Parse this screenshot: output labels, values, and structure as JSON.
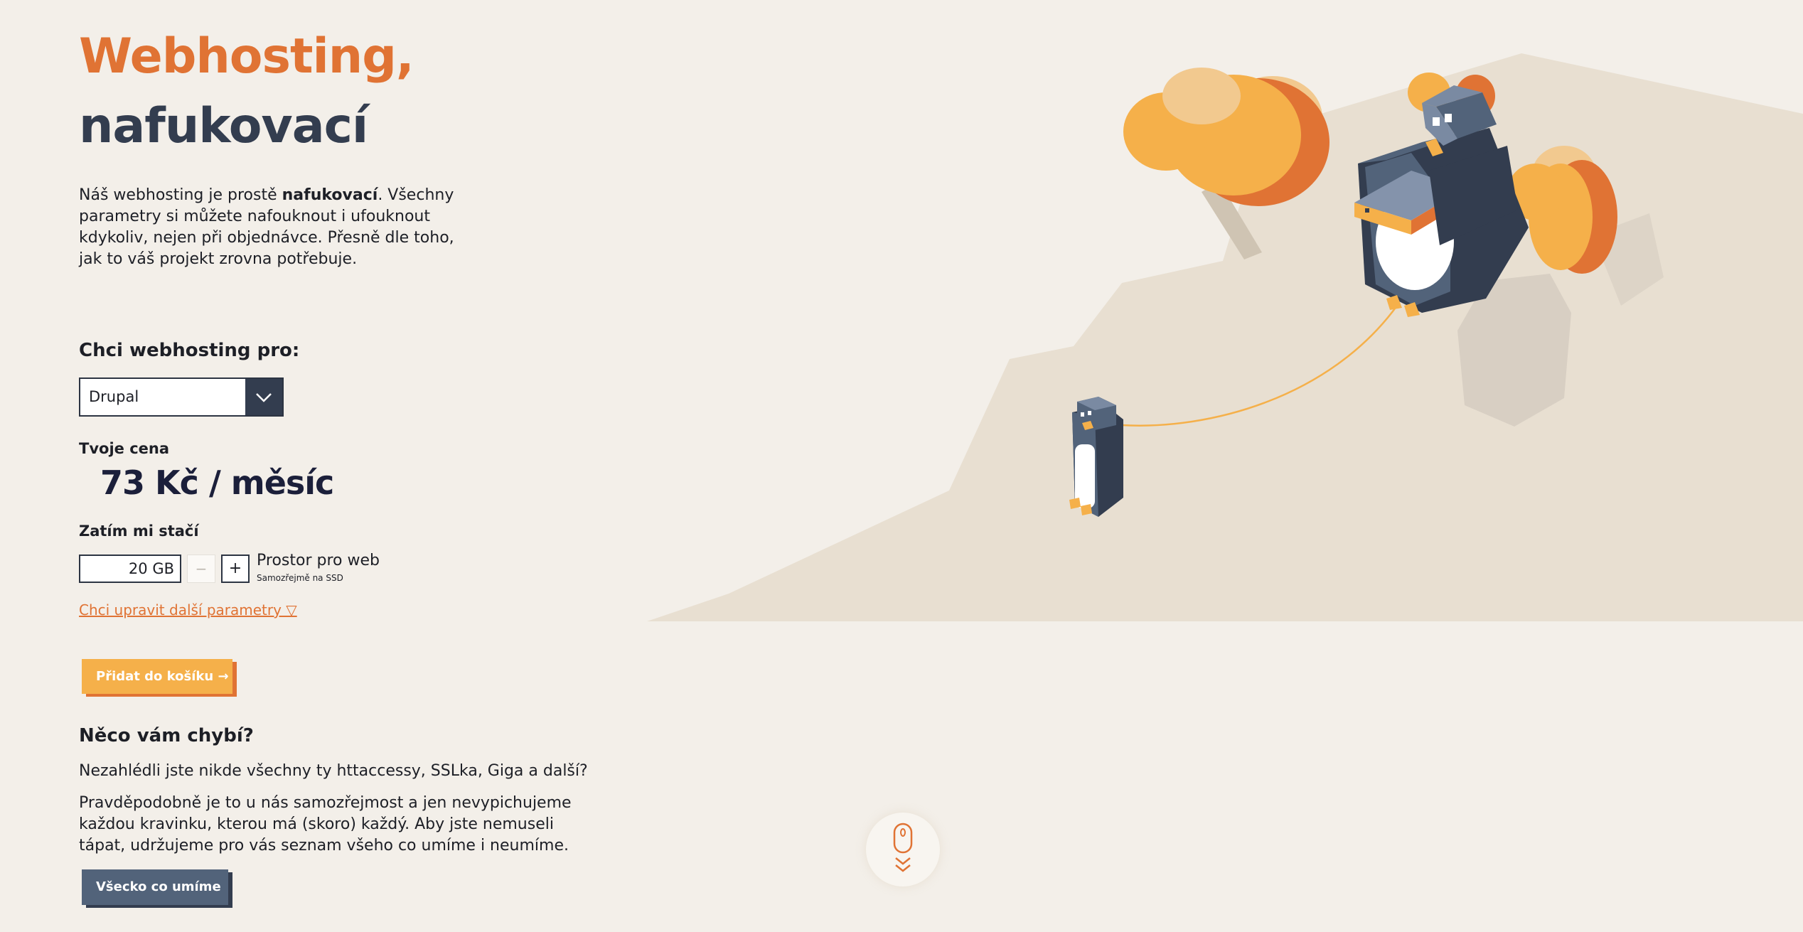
{
  "hero": {
    "title_line1": "Webhosting,",
    "title_line2": "nafukovací",
    "intro_part1": "Náš webhosting je prostě ",
    "intro_bold": "nafukovací",
    "intro_part2": ". Všechny parametry si můžete nafouknout i ufouknout kdykoliv, nejen při objednávce. Přesně dle toho, jak to váš projekt zrovna potřebuje."
  },
  "configurator": {
    "label": "Chci webhosting pro:",
    "select_value": "Drupal",
    "price_label": "Tvoje cena",
    "price_value": "73 Kč / měsíc",
    "stay_label": "Zatím mi stačí",
    "disk_value": "20 GB",
    "minus_label": "−",
    "plus_label": "+",
    "disk_name": "Prostor pro web",
    "disk_sub": "Samozřejmě na SSD",
    "more_link": "Chci upravit další parametry ▽",
    "cart_button": "Přidat do košíku →"
  },
  "missing": {
    "title": "Něco vám chybí?",
    "p1": "Nezahlédli jste nikde všechny ty httaccessy, SSLka, Giga a další?",
    "p2": "Pravděpodobně je to u nás samozřejmost a jen nevypichujeme každou kravinku, kterou má (skoro) každý. Aby jste nemuseli tápat, udržujeme pro vás seznam všeho co umíme i neumíme.",
    "button": "Všecko co umíme"
  },
  "icons": {
    "select_arrow": "chevron-down-icon",
    "scroll": "mouse-scroll-icon"
  },
  "colors": {
    "background": "#f3efe9",
    "accent_orange": "#e07334",
    "accent_yellow": "#f5b04a",
    "slate": "#333d4f",
    "slate_light": "#52637a"
  }
}
